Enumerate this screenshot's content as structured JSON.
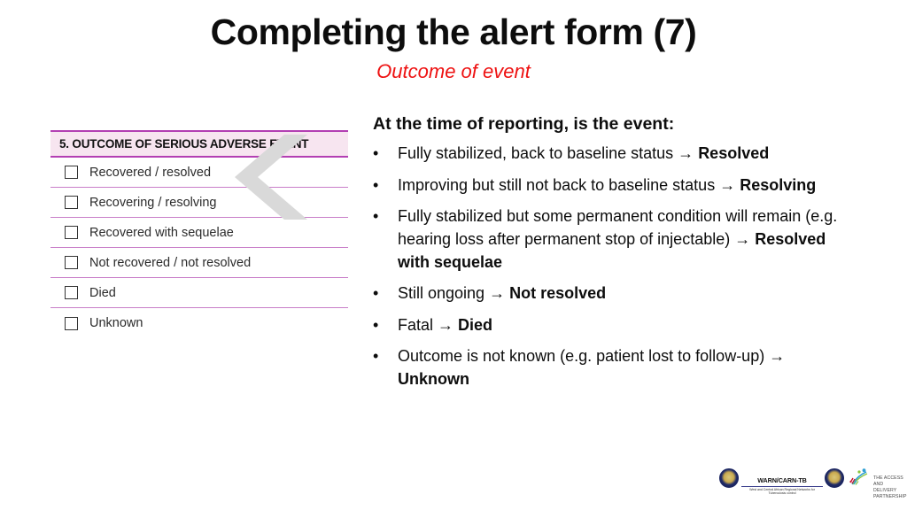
{
  "slide": {
    "title": "Completing the alert form (7)",
    "subtitle": "Outcome of event"
  },
  "form": {
    "section_header": "5. OUTCOME OF SERIOUS ADVERSE EVENT",
    "options": [
      {
        "label": "Recovered / resolved",
        "checked": false
      },
      {
        "label": "Recovering / resolving",
        "checked": false
      },
      {
        "label": "Recovered with sequelae",
        "checked": false
      },
      {
        "label": "Not recovered / not resolved",
        "checked": false
      },
      {
        "label": "Died",
        "checked": false
      },
      {
        "label": "Unknown",
        "checked": false
      }
    ],
    "colors": {
      "header_background": "#f7e5f0",
      "header_border": "#b33fb3",
      "row_divider": "#c87ec8",
      "checkbox_border": "#333333"
    },
    "watermark_icon": "left-chevron-watermark"
  },
  "content": {
    "heading": "At the time of reporting, is the event:",
    "bullet_marker": "•",
    "arrow_glyph": "→",
    "bullets": [
      {
        "lead": "Fully stabilized, back to baseline status ",
        "arrow": "→ ",
        "outcome": "Resolved"
      },
      {
        "lead": "Improving but still not back to baseline status ",
        "arrow": "→ ",
        "outcome": "Resolving"
      },
      {
        "lead": "Fully stabilized but some permanent condition will remain (e.g. hearing loss after permanent stop of injectable) ",
        "arrow": "→ ",
        "outcome": "Resolved with sequelae"
      },
      {
        "lead": "Still ongoing ",
        "arrow": "→ ",
        "outcome": "Not resolved"
      },
      {
        "lead": "Fatal ",
        "arrow": "→ ",
        "outcome": "Died"
      },
      {
        "lead": "Outcome is not known (e.g. patient lost to follow-up) ",
        "arrow": "→ ",
        "outcome": "Unknown"
      }
    ]
  },
  "footer": {
    "warn_carn": {
      "name": "WARN/CARN-TB",
      "tagline": "West and Central African Regional Networks for Tuberculosis control"
    },
    "adp": {
      "line1": "THE ACCESS AND",
      "line2": "DELIVERY PARTNERSHIP"
    }
  },
  "colors": {
    "title_text": "#0d0d0d",
    "subtitle_red": "#ee1111",
    "body_text": "#0d0d0d",
    "watermark_gray": "#d9d9d9"
  }
}
